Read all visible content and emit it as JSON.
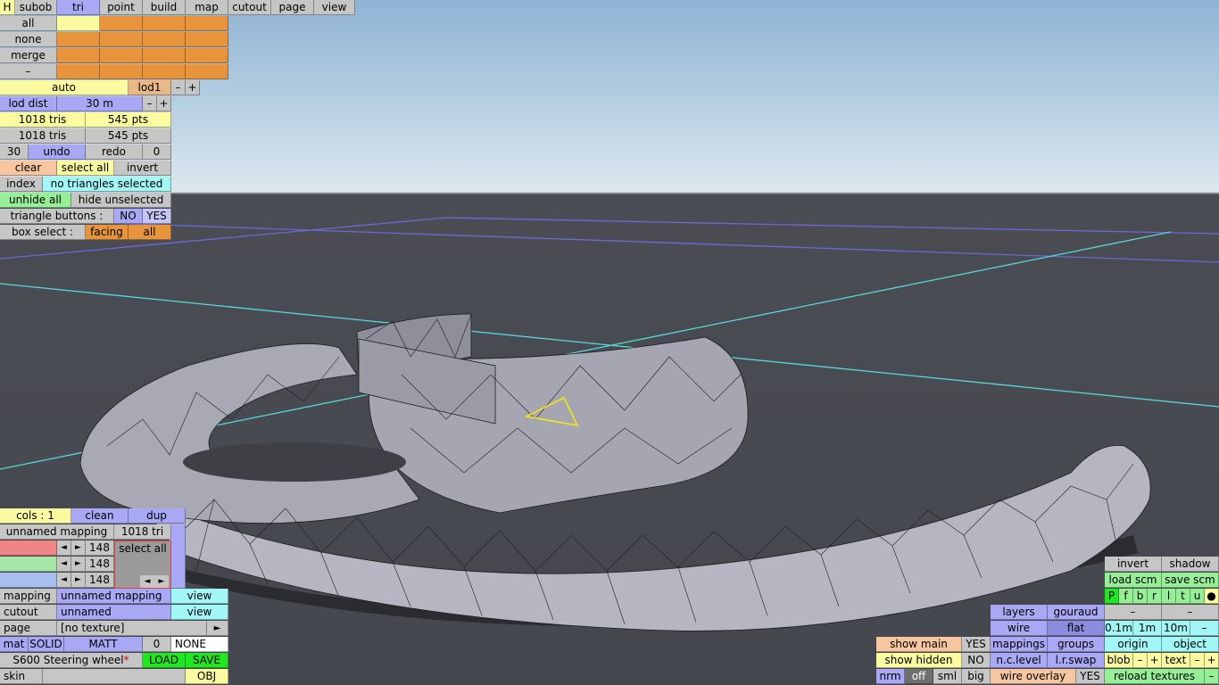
{
  "menu": {
    "h": "H",
    "tabs": [
      "subob",
      "tri",
      "point",
      "build",
      "map",
      "cutout",
      "page",
      "view"
    ],
    "active_tab": "tri"
  },
  "select_rows": [
    "all",
    "none",
    "merge",
    "–"
  ],
  "lod": {
    "auto": "auto",
    "name": "lod1",
    "minus": "–",
    "plus": "+",
    "dist_label": "lod dist",
    "dist_value": "30 m"
  },
  "stats": {
    "tris1": "1018 tris",
    "pts1": "545 pts",
    "tris2": "1018 tris",
    "pts2": "545 pts"
  },
  "undo": {
    "count": "30",
    "undo": "undo",
    "redo": "redo",
    "redo_count": "0"
  },
  "actions": {
    "clear": "clear",
    "select_all": "select all",
    "invert": "invert"
  },
  "index": {
    "label": "index",
    "status": "no triangles selected"
  },
  "hide": {
    "unhide_all": "unhide all",
    "hide_unselected": "hide unselected"
  },
  "tri_buttons": {
    "label": "triangle buttons :",
    "no": "NO",
    "yes": "YES"
  },
  "box_select": {
    "label": "box select :",
    "facing": "facing",
    "all": "all"
  },
  "mapping_panel": {
    "cols": "cols : 1",
    "clean": "clean",
    "dup": "dup",
    "name": "unnamed mapping",
    "tri_count": "1018 tri",
    "values": [
      "148",
      "148",
      "148"
    ],
    "select_all": "select all",
    "left_arrow": "◄",
    "right_arrow": "►"
  },
  "bottom_left": {
    "mapping_label": "mapping",
    "mapping_value": "unnamed mapping",
    "view1": "view",
    "cutout_label": "cutout",
    "cutout_value": "unnamed",
    "view2": "view",
    "page_label": "page",
    "page_value": "[no texture]",
    "page_arrow": "►",
    "mat": "mat",
    "solid": "SOLID",
    "matt": "MATT",
    "mat_num": "0",
    "none": "NONE",
    "object_name": "S600 Steering wheel",
    "modified_mark": "*",
    "load": "LOAD",
    "save": "SAVE",
    "skin": "skin",
    "obj": "OBJ"
  },
  "bottom_right": {
    "invert": "invert",
    "shadow": "shadow",
    "load_scm": "load scm",
    "save_scm": "save scm",
    "flags": [
      "P",
      "f",
      "b",
      "r",
      "l",
      "t",
      "u",
      "●"
    ],
    "dash": "–",
    "layers": "layers",
    "gouraud": "gouraud",
    "wire": "wire",
    "flat": "flat",
    "m01": "0.1m",
    "m1": "1m",
    "m10": "10m",
    "show_main": "show main",
    "show_main_val": "YES",
    "mappings": "mappings",
    "groups": "groups",
    "origin": "origin",
    "object": "object",
    "show_hidden": "show hidden",
    "show_hidden_val": "NO",
    "nc_level": "n.c.level",
    "lr_swap": "l.r.swap",
    "blob": "blob",
    "text": "text",
    "minus": "–",
    "plus": "+",
    "nrm": "nrm",
    "off": "off",
    "sml": "sml",
    "big": "big",
    "wire_overlay": "wire overlay",
    "wire_overlay_val": "YES",
    "reload_textures": "reload textures"
  },
  "colors": {
    "yellow": "#fafaa0",
    "orange": "#e8943c",
    "blue": "#a8a8f4",
    "green": "#96ee96",
    "cyan": "#a2f6f6",
    "gray": "#c6c6c6"
  }
}
